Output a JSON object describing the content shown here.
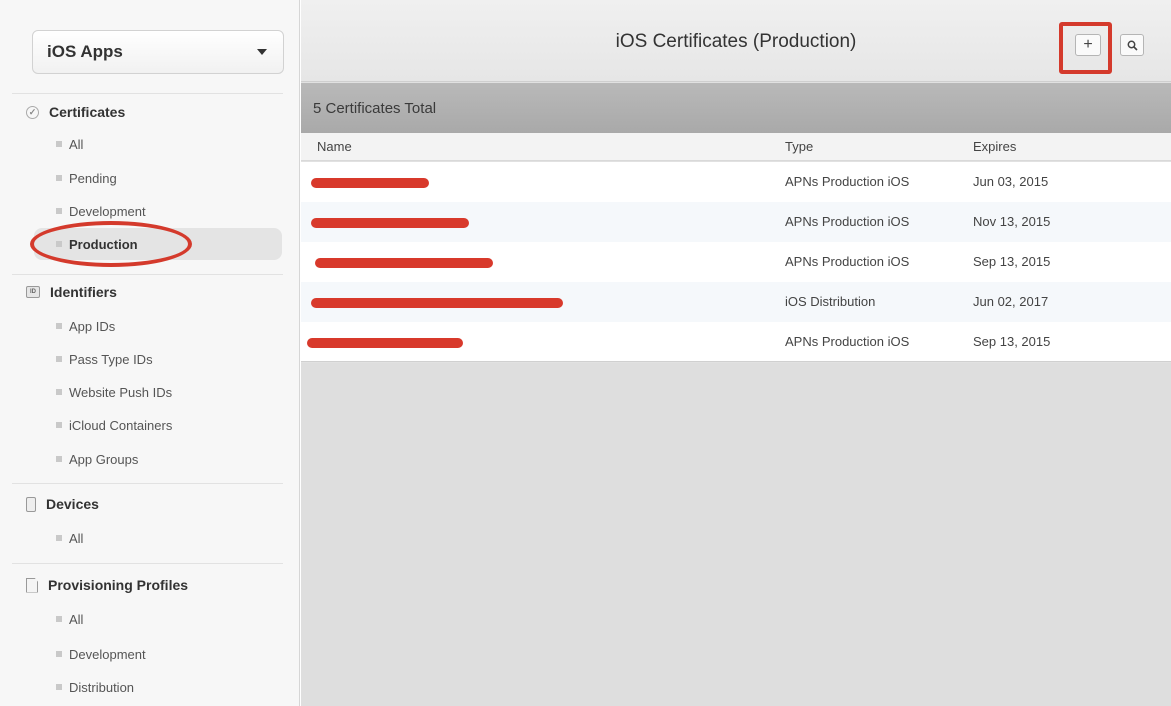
{
  "sidebar": {
    "dropdown_label": "iOS Apps",
    "sections": {
      "certificates": {
        "title": "Certificates",
        "items": [
          "All",
          "Pending",
          "Development",
          "Production"
        ]
      },
      "identifiers": {
        "title": "Identifiers",
        "items": [
          "App IDs",
          "Pass Type IDs",
          "Website Push IDs",
          "iCloud Containers",
          "App Groups"
        ]
      },
      "devices": {
        "title": "Devices",
        "items": [
          "All"
        ]
      },
      "profiles": {
        "title": "Provisioning Profiles",
        "items": [
          "All",
          "Development",
          "Distribution"
        ]
      }
    },
    "identifier_icon_text": "ID"
  },
  "header": {
    "title": "iOS Certificates (Production)",
    "add_label": "+",
    "search_icon": "search-icon"
  },
  "list": {
    "total_label": "5 Certificates Total",
    "columns": [
      "Name",
      "Type",
      "Expires"
    ],
    "rows": [
      {
        "type": "APNs Production iOS",
        "expires": "Jun 03, 2015"
      },
      {
        "type": "APNs Production iOS",
        "expires": "Nov 13, 2015"
      },
      {
        "type": "APNs Production iOS",
        "expires": "Sep 13, 2015"
      },
      {
        "type": "iOS Distribution",
        "expires": "Jun 02, 2017"
      },
      {
        "type": "APNs Production iOS",
        "expires": "Sep 13, 2015"
      }
    ]
  },
  "colors": {
    "annotation_red": "#d43a2c",
    "selected_bg": "#e4e4e4",
    "stripe_bg": "#f5f8fb"
  }
}
